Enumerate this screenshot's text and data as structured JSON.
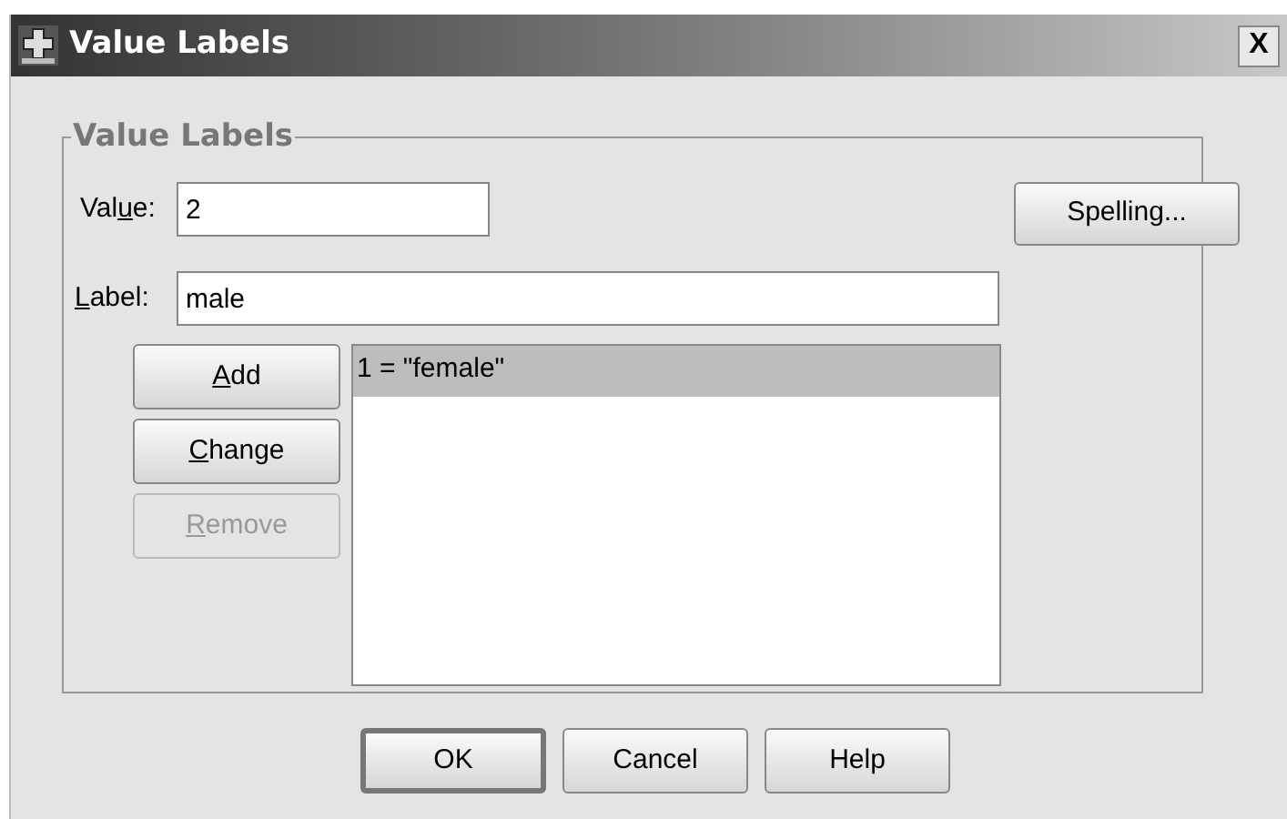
{
  "window": {
    "title": "Value Labels",
    "close": "X"
  },
  "group": {
    "title": "Value Labels"
  },
  "value_field": {
    "label_parts": {
      "before": "Val",
      "key": "u",
      "after": "e:"
    },
    "value": "2"
  },
  "label_field": {
    "label_parts": {
      "key": "L",
      "after": "abel:"
    },
    "value": "male"
  },
  "side_buttons": [
    {
      "label_parts": {
        "key": "A",
        "after": "dd"
      },
      "disabled": false
    },
    {
      "label_parts": {
        "key": "C",
        "after": "hange"
      },
      "disabled": false
    },
    {
      "label_parts": {
        "key": "R",
        "after": "emove"
      },
      "disabled": true
    }
  ],
  "spelling_button": "Spelling...",
  "list_items": [
    {
      "text": "1 = \"female\"",
      "selected": true
    }
  ],
  "footer_buttons": [
    {
      "label": "OK",
      "default": true
    },
    {
      "label": "Cancel",
      "default": false
    },
    {
      "label": "Help",
      "default": false
    }
  ]
}
